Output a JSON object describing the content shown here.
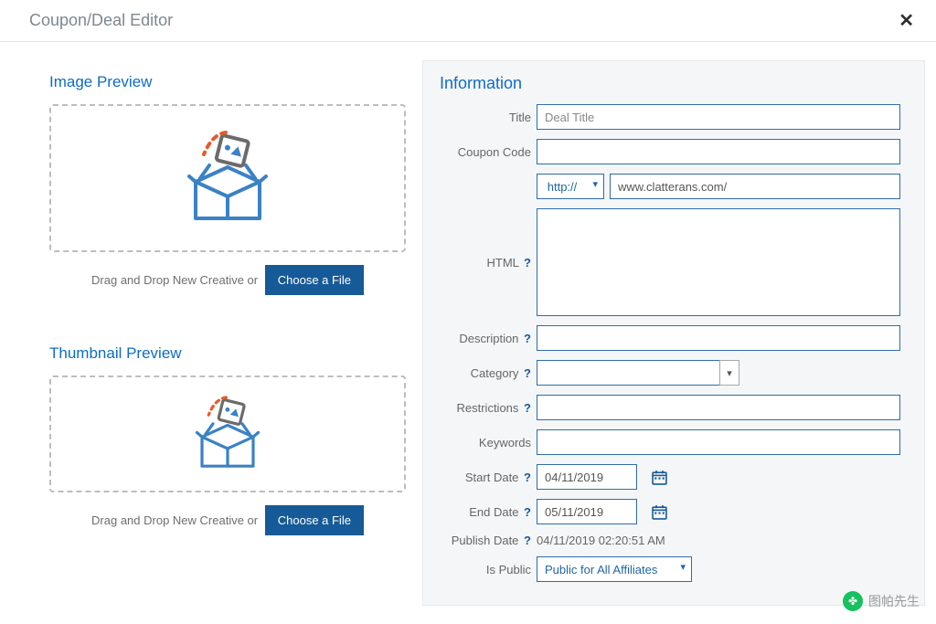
{
  "modal": {
    "title": "Coupon/Deal Editor"
  },
  "left": {
    "image_heading": "Image Preview",
    "thumb_heading": "Thumbnail Preview",
    "drop_text": "Drag and Drop New Creative or",
    "choose_file": "Choose a File"
  },
  "info": {
    "heading": "Information",
    "labels": {
      "title": "Title",
      "coupon": "Coupon Code",
      "html": "HTML",
      "description": "Description",
      "category": "Category",
      "restrictions": "Restrictions",
      "keywords": "Keywords",
      "start": "Start Date",
      "end": "End Date",
      "publish": "Publish Date",
      "ispublic": "Is Public"
    },
    "values": {
      "title_placeholder": "Deal Title",
      "protocol": "http://",
      "url": "www.clatterans.com/",
      "start": "04/11/2019",
      "end": "05/11/2019",
      "publish": "04/11/2019 02:20:51 AM",
      "ispublic": "Public for All Affiliates"
    }
  },
  "watermark": {
    "text": "图帕先生"
  }
}
